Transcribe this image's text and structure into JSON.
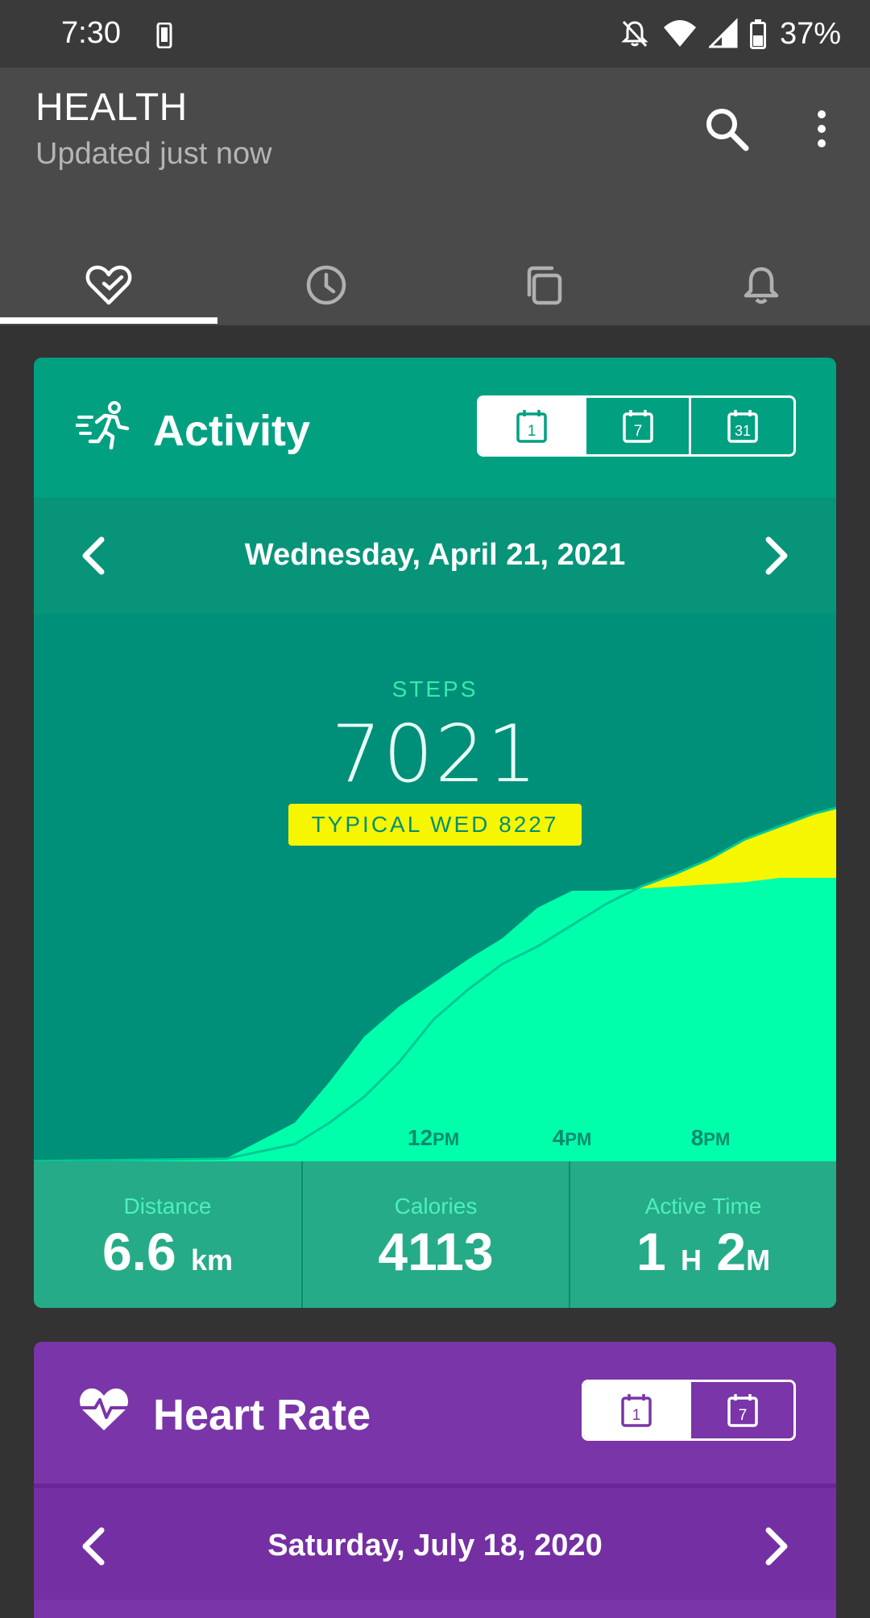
{
  "status_bar": {
    "time": "7:30",
    "battery_percent": "37%",
    "icons": [
      "phone-icon",
      "notifications-off-icon",
      "wifi-icon",
      "cell-signal-icon",
      "battery-icon"
    ]
  },
  "app_bar": {
    "title": "HEALTH",
    "subtitle": "Updated just now",
    "actions": [
      "search-icon",
      "more-vert-icon"
    ]
  },
  "tabs": [
    {
      "icon": "heart-check-icon",
      "selected": true
    },
    {
      "icon": "clock-icon",
      "selected": false
    },
    {
      "icon": "copy-icon",
      "selected": false
    },
    {
      "icon": "bell-icon",
      "selected": false
    }
  ],
  "activity": {
    "title": "Activity",
    "icon": "running-icon",
    "range_options": [
      {
        "label": "1",
        "selected": true
      },
      {
        "label": "7",
        "selected": false
      },
      {
        "label": "31",
        "selected": false
      }
    ],
    "date": "Wednesday, April 21, 2021",
    "steps_label": "STEPS",
    "steps_value": "7021",
    "typical_badge": "TYPICAL WED 8227",
    "stats": [
      {
        "label": "Distance",
        "value": "6.6",
        "unit": "km"
      },
      {
        "label": "Calories",
        "value": "4113",
        "unit": ""
      },
      {
        "label": "Active Time",
        "value": "1",
        "unit": "H",
        "value2": "2",
        "unit2": "M"
      }
    ],
    "colors": {
      "card": "#00a081",
      "chart_fill": "#00ffaa",
      "typical_fill": "#f6f600",
      "stats_bg": "#25ab88"
    }
  },
  "chart_data": {
    "type": "area",
    "x_ticks": [
      {
        "label": "12",
        "suffix": "PM",
        "hour": 12
      },
      {
        "label": "4",
        "suffix": "PM",
        "hour": 16
      },
      {
        "label": "8",
        "suffix": "PM",
        "hour": 20
      }
    ],
    "series": [
      {
        "name": "",
        "hours": [
          0,
          6,
          8,
          9,
          10,
          11,
          13,
          14,
          15,
          16,
          17,
          18,
          20,
          21,
          22,
          24
        ],
        "values": [
          0,
          60,
          900,
          1850,
          2900,
          3600,
          4700,
          5200,
          5900,
          6300,
          6300,
          6350,
          6450,
          6500,
          6600,
          6600
        ]
      },
      {
        "name": "",
        "hours": [
          0,
          6,
          8,
          9,
          10,
          11,
          12,
          13,
          14,
          15,
          16,
          17,
          18,
          19,
          20,
          21,
          22,
          23,
          24
        ],
        "values": [
          0,
          60,
          400,
          900,
          1500,
          2300,
          3300,
          4000,
          4600,
          5000,
          5500,
          6000,
          6400,
          6700,
          7050,
          7500,
          7800,
          8100,
          8227
        ]
      }
    ],
    "grid": false
  },
  "heart_rate": {
    "title": "Heart Rate",
    "icon": "heart-pulse-icon",
    "range_options": [
      {
        "label": "1",
        "selected": true
      },
      {
        "label": "7",
        "selected": false
      }
    ],
    "date": "Saturday, July 18, 2020",
    "colors": {
      "card": "#7a35a8"
    }
  }
}
